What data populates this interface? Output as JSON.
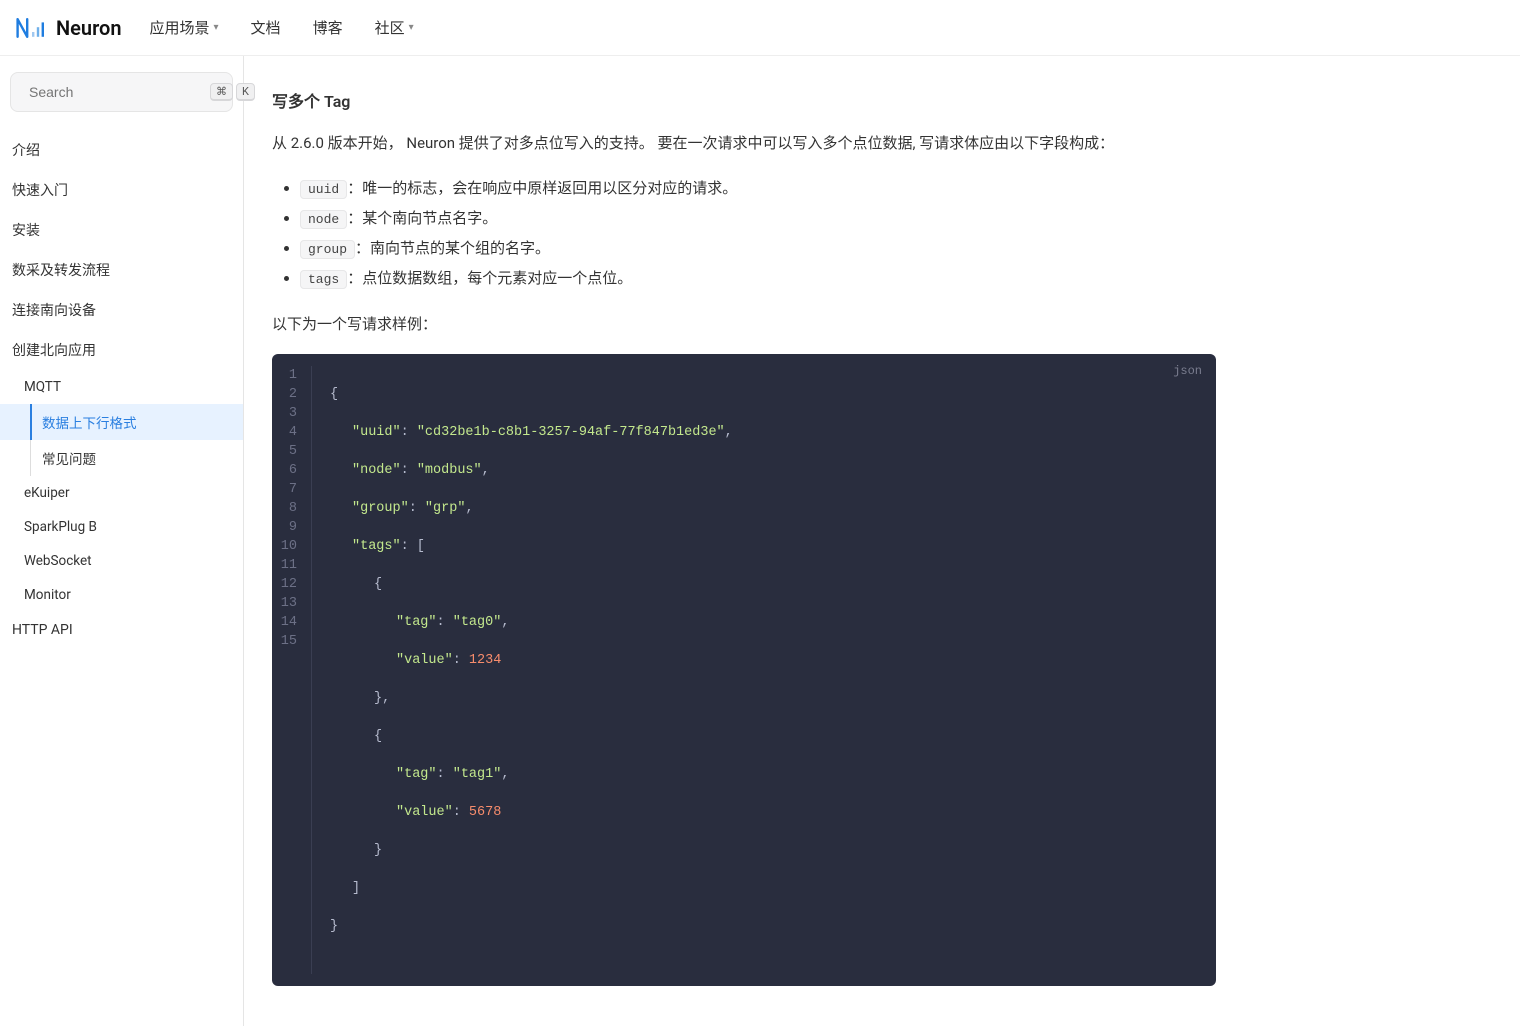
{
  "brand": "Neuron",
  "nav": {
    "scenes": "应用场景",
    "docs": "文档",
    "blog": "博客",
    "community": "社区"
  },
  "search": {
    "placeholder": "Search",
    "k0": "⌘",
    "k1": "K"
  },
  "sidebar": {
    "intro": "介绍",
    "quickstart": "快速入门",
    "install": "安装",
    "collect": "数采及转发流程",
    "connect": "连接南向设备",
    "createNorth": "创建北向应用",
    "mqtt": "MQTT",
    "dataFmt": "数据上下行格式",
    "faq": "常见问题",
    "ekuiper": "eKuiper",
    "sparkplug": "SparkPlug B",
    "websocket": "WebSocket",
    "monitor": "Monitor",
    "httpapi": "HTTP API"
  },
  "content": {
    "heading": "写多个 Tag",
    "p1": "从 2.6.0 版本开始， Neuron 提供了对多点位写入的支持。 要在一次请求中可以写入多个点位数据, 写请求体应由以下字段构成：",
    "list": {
      "uuid_code": "uuid",
      "uuid_text": "：唯一的标志，会在响应中原样返回用以区分对应的请求。",
      "node_code": "node",
      "node_text": "：某个南向节点名字。",
      "group_code": "group",
      "group_text": "：南向节点的某个组的名字。",
      "tags_code": "tags",
      "tags_text": "：点位数据数组，每个元素对应一个点位。"
    },
    "p2": "以下为一个写请求样例：",
    "code_lang": "json",
    "code": {
      "uuid_k": "\"uuid\"",
      "uuid_v": "\"cd32be1b-c8b1-3257-94af-77f847b1ed3e\"",
      "node_k": "\"node\"",
      "node_v": "\"modbus\"",
      "group_k": "\"group\"",
      "group_v": "\"grp\"",
      "tags_k": "\"tags\"",
      "tag_k": "\"tag\"",
      "tag0_v": "\"tag0\"",
      "tag1_v": "\"tag1\"",
      "value_k": "\"value\"",
      "v0": "1234",
      "v1": "5678",
      "lines": [
        "1",
        "2",
        "3",
        "4",
        "5",
        "6",
        "7",
        "8",
        "9",
        "10",
        "11",
        "12",
        "13",
        "14",
        "15"
      ]
    }
  }
}
